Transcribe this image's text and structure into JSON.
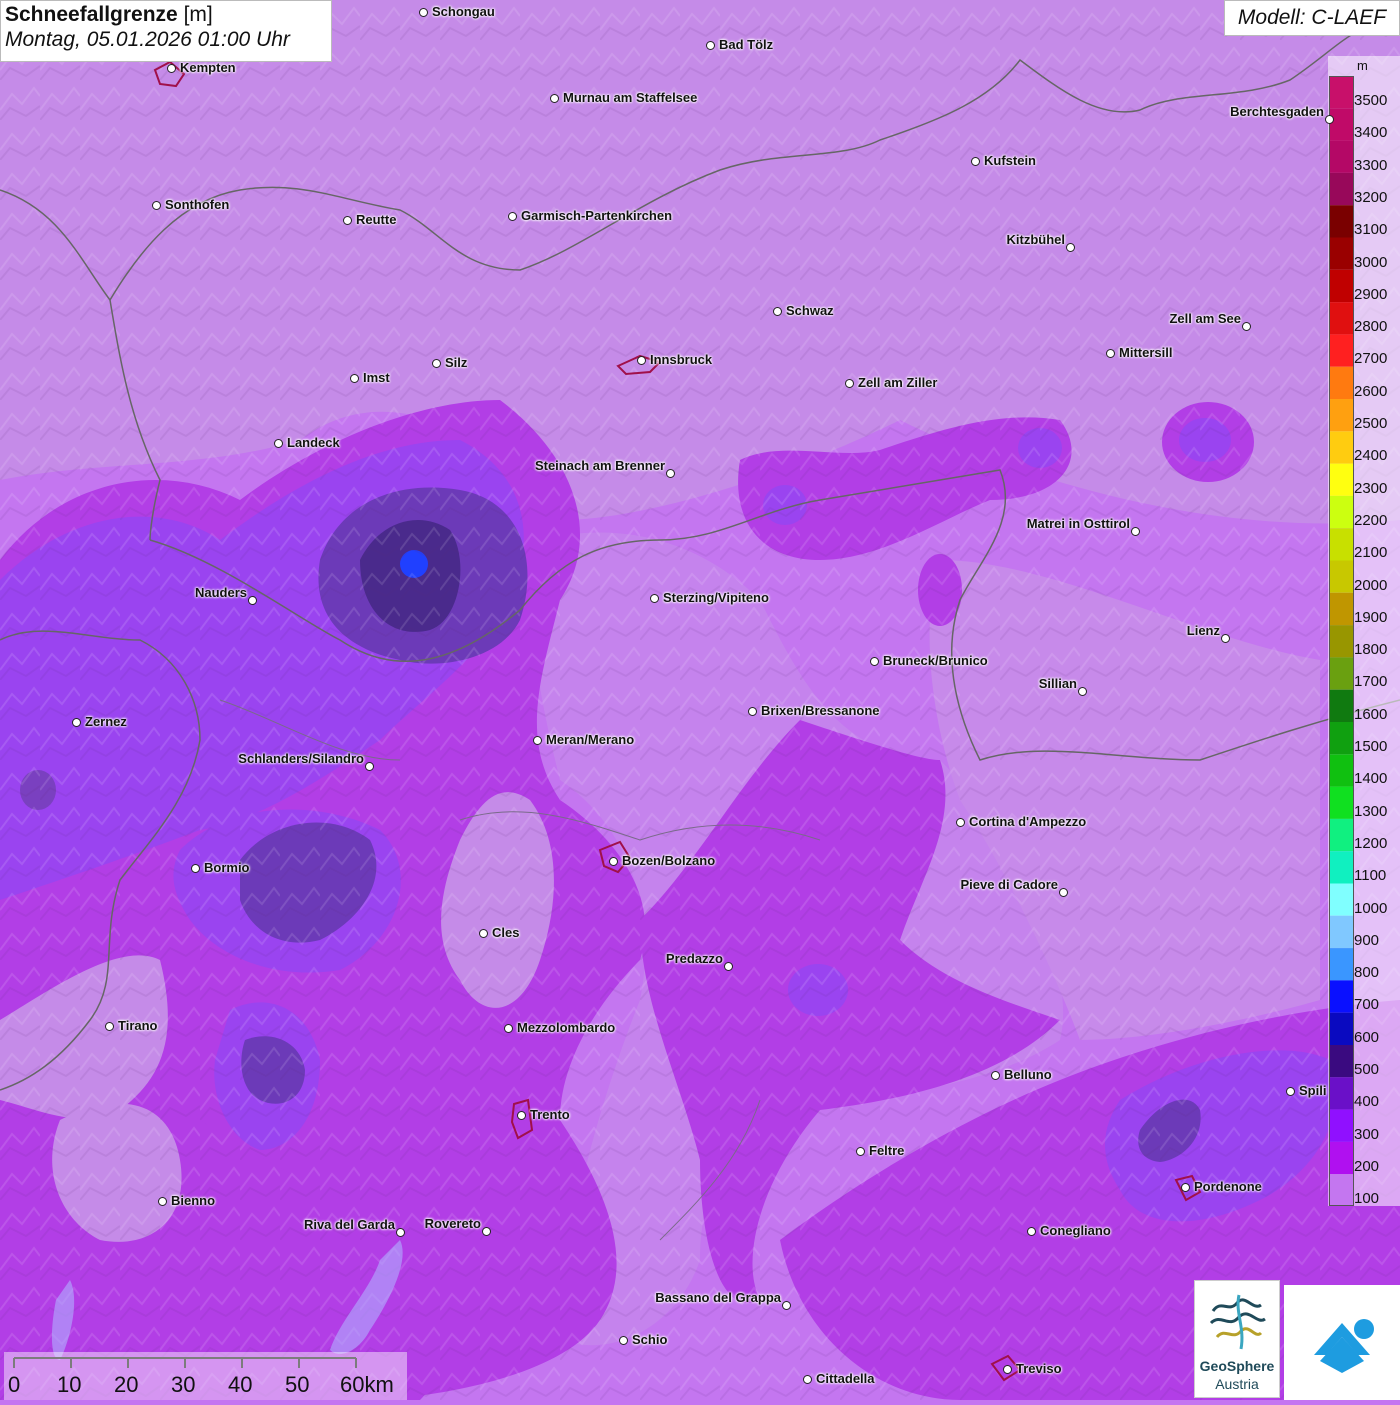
{
  "title": {
    "parameter": "Schneefallgrenze",
    "unit": "[m]",
    "datetime": "Montag, 05.01.2026 01:00 Uhr"
  },
  "model": "Modell: C-LAEF",
  "legend": {
    "unit": "m",
    "levels": [
      {
        "value": "3500",
        "color": "#c8106a"
      },
      {
        "value": "3400",
        "color": "#c00a68"
      },
      {
        "value": "3300",
        "color": "#b40866"
      },
      {
        "value": "3200",
        "color": "#98085a"
      },
      {
        "value": "3100",
        "color": "#7a0000"
      },
      {
        "value": "3000",
        "color": "#9a0000"
      },
      {
        "value": "2900",
        "color": "#c00000"
      },
      {
        "value": "2800",
        "color": "#e01010"
      },
      {
        "value": "2700",
        "color": "#ff2020"
      },
      {
        "value": "2600",
        "color": "#ff7a10"
      },
      {
        "value": "2500",
        "color": "#ffa010"
      },
      {
        "value": "2400",
        "color": "#ffcc10"
      },
      {
        "value": "2300",
        "color": "#ffff10"
      },
      {
        "value": "2200",
        "color": "#ccff10"
      },
      {
        "value": "2100",
        "color": "#c8e000"
      },
      {
        "value": "2000",
        "color": "#c8c800"
      },
      {
        "value": "1900",
        "color": "#c09600"
      },
      {
        "value": "1800",
        "color": "#989600"
      },
      {
        "value": "1700",
        "color": "#6aa010"
      },
      {
        "value": "1600",
        "color": "#107a10"
      },
      {
        "value": "1500",
        "color": "#10a010"
      },
      {
        "value": "1400",
        "color": "#10c010"
      },
      {
        "value": "1300",
        "color": "#10e020"
      },
      {
        "value": "1200",
        "color": "#10f080"
      },
      {
        "value": "1100",
        "color": "#10f0c0"
      },
      {
        "value": "1000",
        "color": "#80ffff"
      },
      {
        "value": "900",
        "color": "#80c8ff"
      },
      {
        "value": "800",
        "color": "#3a96ff"
      },
      {
        "value": "700",
        "color": "#0a10ff"
      },
      {
        "value": "600",
        "color": "#0a0ac0"
      },
      {
        "value": "500",
        "color": "#3a0a80"
      },
      {
        "value": "400",
        "color": "#6a10c8"
      },
      {
        "value": "300",
        "color": "#9010ff"
      },
      {
        "value": "200",
        "color": "#b010f0"
      },
      {
        "value": "100",
        "color": "#c476f0"
      }
    ]
  },
  "scale_bar": {
    "ticks": [
      "0",
      "10",
      "20",
      "30",
      "40",
      "50",
      "60km"
    ]
  },
  "places": [
    {
      "name": "Schongau"
    },
    {
      "name": "Bad Tölz"
    },
    {
      "name": "Kempten"
    },
    {
      "name": "Murnau am Staffelsee"
    },
    {
      "name": "Berchtesgaden"
    },
    {
      "name": "Kufstein"
    },
    {
      "name": "Sonthofen"
    },
    {
      "name": "Reutte"
    },
    {
      "name": "Garmisch-Partenkirchen"
    },
    {
      "name": "Kitzbühel"
    },
    {
      "name": "Schwaz"
    },
    {
      "name": "Zell am See"
    },
    {
      "name": "Innsbruck"
    },
    {
      "name": "Mittersill"
    },
    {
      "name": "Silz"
    },
    {
      "name": "Imst"
    },
    {
      "name": "Zell am Ziller"
    },
    {
      "name": "Landeck"
    },
    {
      "name": "Steinach am Brenner"
    },
    {
      "name": "Matrei in Osttirol"
    },
    {
      "name": "Nauders"
    },
    {
      "name": "Sterzing/Vipiteno"
    },
    {
      "name": "Lienz"
    },
    {
      "name": "Bruneck/Brunico"
    },
    {
      "name": "Sillian"
    },
    {
      "name": "Brixen/Bressanone"
    },
    {
      "name": "Zernez"
    },
    {
      "name": "Meran/Merano"
    },
    {
      "name": "Schlanders/Silandro"
    },
    {
      "name": "Cortina d'Ampezzo"
    },
    {
      "name": "Bozen/Bolzano"
    },
    {
      "name": "Bormio"
    },
    {
      "name": "Pieve di Cadore"
    },
    {
      "name": "Cles"
    },
    {
      "name": "Predazzo"
    },
    {
      "name": "Tirano"
    },
    {
      "name": "Mezzolombardo"
    },
    {
      "name": "Belluno"
    },
    {
      "name": "Spili"
    },
    {
      "name": "Trento"
    },
    {
      "name": "Feltre"
    },
    {
      "name": "Pordenone"
    },
    {
      "name": "Bienno"
    },
    {
      "name": "Riva del Garda"
    },
    {
      "name": "Rovereto"
    },
    {
      "name": "Conegliano"
    },
    {
      "name": "Bassano del Grappa"
    },
    {
      "name": "Schio"
    },
    {
      "name": "Treviso"
    },
    {
      "name": "Cittadella"
    }
  ],
  "logos": {
    "geosphere_line1": "GeoSphere",
    "geosphere_line2": "Austria"
  }
}
